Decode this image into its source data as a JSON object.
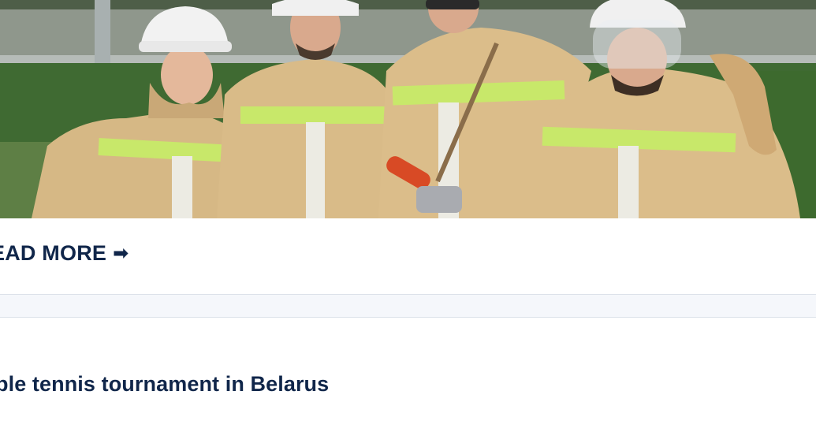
{
  "article": {
    "image_alt": "",
    "read_more_label": "EAD MORE",
    "read_more_arrow": "➡"
  },
  "next_article": {
    "title": "ble tennis tournament in Belarus"
  },
  "colors": {
    "heading": "#10264a",
    "separator_bg": "#f5f7fb",
    "separator_border": "#dde2ea"
  }
}
